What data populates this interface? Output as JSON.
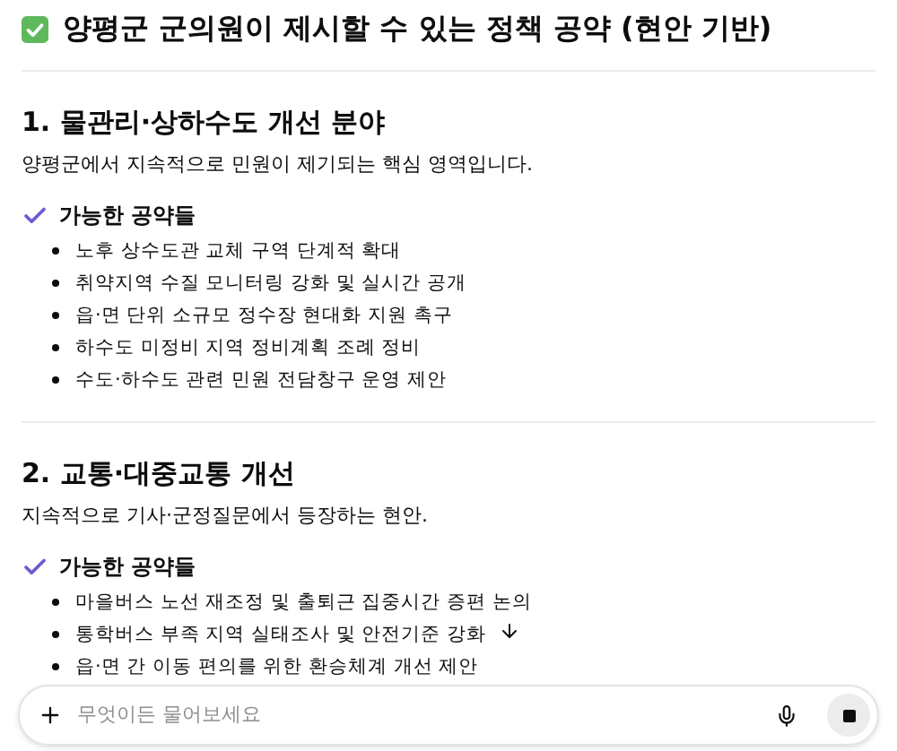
{
  "title": "양평군 군의원이 제시할 수 있는 정책 공약 (현안 기반)",
  "sections": [
    {
      "heading": "1. 물관리·상하수도 개선 분야",
      "description": "양평군에서 지속적으로 민원이 제기되는 핵심 영역입니다.",
      "subheading": "가능한 공약들",
      "items": [
        "노후 상수도관 교체 구역 단계적 확대",
        "취약지역 수질 모니터링 강화 및 실시간 공개",
        "읍·면 단위 소규모 정수장 현대화 지원 촉구",
        "하수도 미정비 지역 정비계획 조례 정비",
        "수도·하수도 관련 민원 전담창구 운영 제안"
      ]
    },
    {
      "heading": "2. 교통·대중교통 개선",
      "description": "지속적으로 기사·군정질문에서 등장하는 현안.",
      "subheading": "가능한 공약들",
      "items": [
        "마을버스 노선 재조정 및 출퇴근 집중시간 증편 논의",
        "통학버스 부족 지역 실태조사 및 안전기준 강화",
        "읍·면 간 이동 편의를 위한 환승체계 개선 제안"
      ]
    }
  ],
  "composer": {
    "placeholder": "무엇이든 물어보세요"
  }
}
